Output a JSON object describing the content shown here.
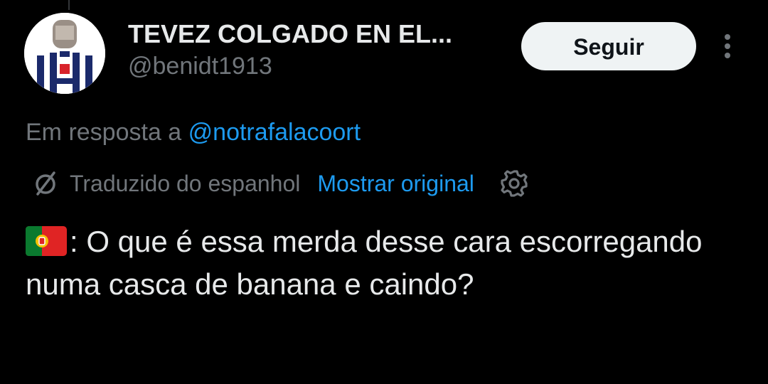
{
  "colors": {
    "background": "#000000",
    "primary_text": "#e7e9ea",
    "secondary_text": "#71767b",
    "link": "#1d9bf0",
    "button_bg": "#eff3f4",
    "button_text": "#0f1419"
  },
  "author": {
    "display_name": "TEVEZ COLGADO EN EL...",
    "handle": "@benidt1913",
    "avatar_icon": "avatar-blue-white-striped-jersey"
  },
  "header": {
    "follow_label": "Seguir",
    "more_icon": "more-vertical-icon"
  },
  "reply": {
    "prefix": "Em resposta a ",
    "mention": "@notrafalacoort"
  },
  "translation": {
    "icon": "translate-icon",
    "label": "Traduzido do espanhol",
    "show_original": "Mostrar original",
    "settings_icon": "gear-icon"
  },
  "tweet": {
    "flag_icon": "portugal-flag-icon",
    "text": ": O que é essa merda desse cara escorregando numa casca de banana e caindo?"
  }
}
